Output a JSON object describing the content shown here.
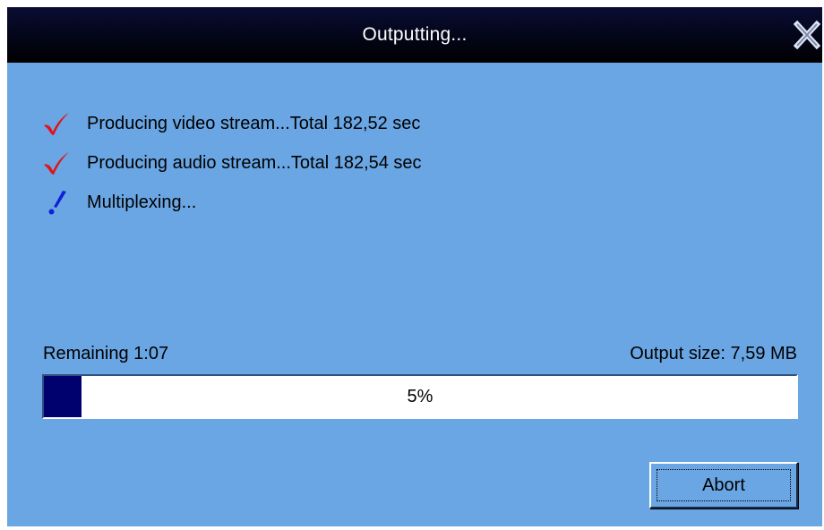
{
  "window": {
    "title": "Outputting..."
  },
  "steps": [
    {
      "label": "Producing video stream...Total 182,52 sec",
      "status": "done",
      "icon": "checkmark-icon",
      "icon_color": "#e0141a"
    },
    {
      "label": "Producing audio stream...Total 182,54 sec",
      "status": "done",
      "icon": "checkmark-icon",
      "icon_color": "#e0141a"
    },
    {
      "label": "Multiplexing...",
      "status": "in-progress",
      "icon": "exclamation-icon",
      "icon_color": "#1020d8"
    }
  ],
  "status": {
    "remaining": "Remaining 1:07",
    "output_size": "Output size: 7,59 MB"
  },
  "progress": {
    "percent": 5,
    "label": "5%",
    "fill_color": "#00006e"
  },
  "buttons": {
    "abort_label": "Abort"
  },
  "colors": {
    "background": "#6aa6e3",
    "titlebar": "#000000"
  }
}
